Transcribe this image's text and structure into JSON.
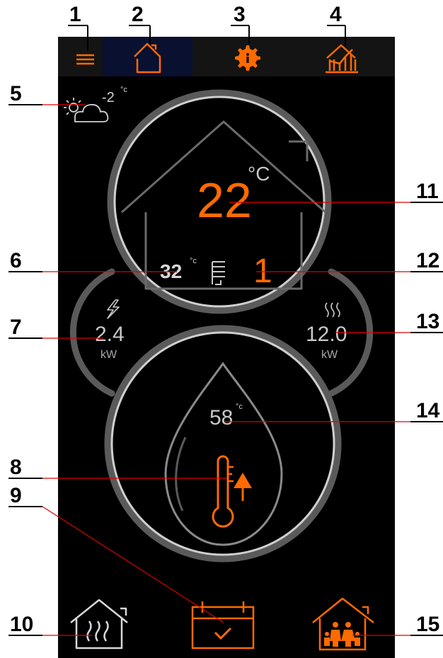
{
  "colors": {
    "accent": "#ff6a00",
    "ring": "#c8c8c8",
    "ring_dark": "#5a5a5a",
    "text_gray": "#bdbdbd",
    "callout_line": "#e00000",
    "background": "#000000",
    "nav_bar": "#141414",
    "active_tab": "#0a1030"
  },
  "nav": {
    "menu_icon": "hamburger-menu-icon",
    "home_icon": "house-icon",
    "settings_icon": "gear-info-icon",
    "stats_icon": "bar-chart-house-icon"
  },
  "weather": {
    "icon": "sun-cloud-icon",
    "outdoor_temp": "-2",
    "unit": "°c"
  },
  "room": {
    "temperature": "22",
    "unit": "°C",
    "supply_temp": "32",
    "supply_unit": "°c",
    "radiator_icon": "radiator-icon",
    "circuit": "1"
  },
  "power": {
    "icon": "lightning-icon",
    "value": "2.4",
    "unit": "kW"
  },
  "heat": {
    "icon": "heat-waves-icon",
    "value": "12.0",
    "unit": "kW"
  },
  "water": {
    "temperature": "58",
    "unit": "°c",
    "icon": "thermometer-boost-icon"
  },
  "bottom": {
    "heating_icon": "house-heating-icon",
    "schedule_icon": "calendar-check-icon",
    "family_icon": "house-family-icon"
  },
  "callouts": [
    "1",
    "2",
    "3",
    "4",
    "5",
    "6",
    "7",
    "8",
    "9",
    "10",
    "11",
    "12",
    "13",
    "14",
    "15"
  ]
}
